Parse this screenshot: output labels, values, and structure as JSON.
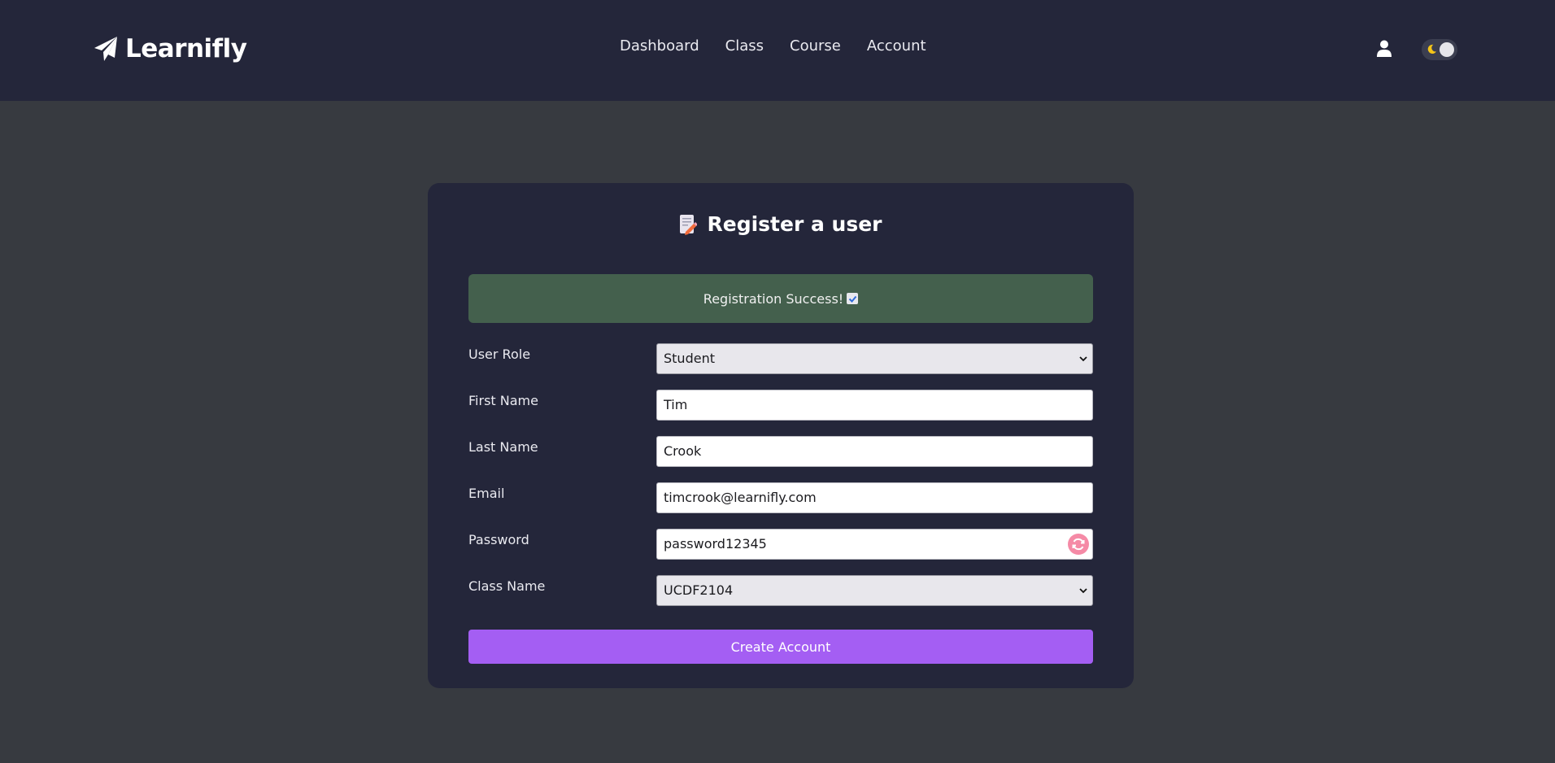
{
  "brand": {
    "name": "Learnifly",
    "icon": "paper-plane-icon"
  },
  "nav": {
    "links": [
      "Dashboard",
      "Class",
      "Course",
      "Account"
    ]
  },
  "header_actions": {
    "user_icon": "user-icon",
    "theme_toggle_icon": "moon-icon"
  },
  "form": {
    "title": "Register a user",
    "title_icon": "memo-icon",
    "alert": {
      "text": "Registration Success!",
      "icon": "check-box-icon"
    },
    "fields": {
      "user_role": {
        "label": "User Role",
        "value": "Student"
      },
      "first_name": {
        "label": "First Name",
        "value": "Tim"
      },
      "last_name": {
        "label": "Last Name",
        "value": "Crook"
      },
      "email": {
        "label": "Email",
        "value": "timcrook@learnifly.com"
      },
      "password": {
        "label": "Password",
        "value": "password12345",
        "action_icon": "refresh-icon"
      },
      "class_name": {
        "label": "Class Name",
        "value": "UCDF2104"
      }
    },
    "submit_label": "Create Account"
  },
  "colors": {
    "header_bg": "#24263a",
    "page_bg": "#373a40",
    "card_bg": "#24263a",
    "alert_bg": "#44604d",
    "accent": "#a45ef3",
    "refresh_icon": "#f58aa6"
  }
}
